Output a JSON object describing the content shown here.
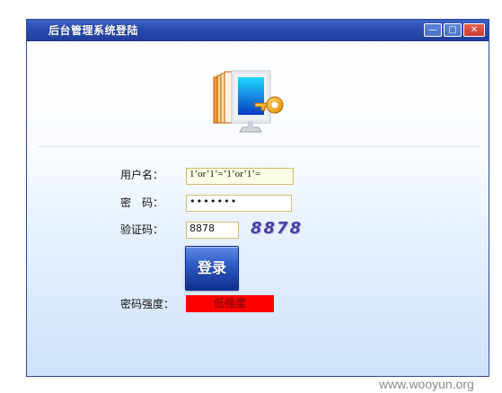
{
  "window": {
    "title": "后台管理系统登陆"
  },
  "titlebar": {
    "minimize_icon": "minimize-icon",
    "maximize_icon": "maximize-icon",
    "close_icon": "close-icon"
  },
  "form": {
    "username_label": "用户名：",
    "username_value": "1’or’1’=’1’or’1’=",
    "password_label": "密　码：",
    "password_value": "•••••••",
    "captcha_label": "验证码：",
    "captcha_value": "8878",
    "captcha_image_text": "8878",
    "login_button_label": "登录",
    "strength_label": "密码强度：",
    "strength_value": "低强度"
  },
  "watermark": {
    "text": "www.wooyun.org"
  },
  "colors": {
    "titlebar": "#2a4cae",
    "login_button": "#2e59c4",
    "strength_low": "#ff0000",
    "input_border": "#d4bb72"
  }
}
